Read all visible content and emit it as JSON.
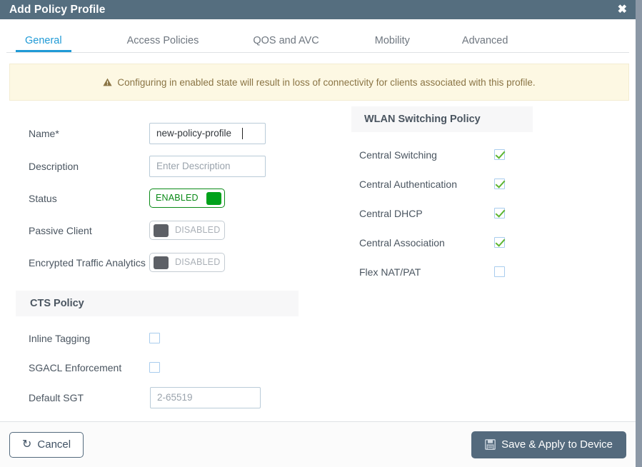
{
  "window": {
    "title": "Add Policy Profile",
    "close_icon": "close-icon",
    "close_glyph": "✖"
  },
  "tabs": [
    {
      "label": "General",
      "active": true
    },
    {
      "label": "Access Policies",
      "active": false
    },
    {
      "label": "QOS and AVC",
      "active": false
    },
    {
      "label": "Mobility",
      "active": false
    },
    {
      "label": "Advanced",
      "active": false
    }
  ],
  "banner": {
    "icon": "warning-triangle-icon",
    "message": "Configuring in enabled state will result in loss of connectivity for clients associated with this profile."
  },
  "general": {
    "name": {
      "label": "Name*",
      "value": "new-policy-profile",
      "placeholder": ""
    },
    "description": {
      "label": "Description",
      "value": "",
      "placeholder": "Enter Description"
    },
    "status": {
      "label": "Status",
      "state": "ENABLED"
    },
    "passive_client": {
      "label": "Passive Client",
      "state": "DISABLED"
    },
    "encrypted_traffic_analytics": {
      "label": "Encrypted Traffic Analytics",
      "state": "DISABLED"
    }
  },
  "cts_policy": {
    "header": "CTS Policy",
    "inline_tagging": {
      "label": "Inline Tagging",
      "checked": false
    },
    "sgacl_enforcement": {
      "label": "SGACL Enforcement",
      "checked": false
    },
    "default_sgt": {
      "label": "Default SGT",
      "value": "",
      "placeholder": "2-65519"
    }
  },
  "wlan_switching_policy": {
    "header": "WLAN Switching Policy",
    "items": [
      {
        "label": "Central Switching",
        "checked": true
      },
      {
        "label": "Central Authentication",
        "checked": true
      },
      {
        "label": "Central DHCP",
        "checked": true
      },
      {
        "label": "Central Association",
        "checked": true
      },
      {
        "label": "Flex NAT/PAT",
        "checked": false
      }
    ]
  },
  "footer": {
    "cancel": {
      "label": "Cancel",
      "icon": "undo-arrow-icon",
      "glyph": "↺"
    },
    "save": {
      "label": "Save & Apply to Device",
      "icon": "floppy-disk-save-icon"
    }
  },
  "colors": {
    "titlebar": "#556e7f",
    "accent_tab": "#1f9ad6",
    "banner_bg": "#fdf8e3",
    "banner_text": "#8a7444",
    "toggle_on": "#00a21b",
    "toggle_off": "#5d6066",
    "check_green": "#5cb531",
    "primary_button": "#546a7d"
  }
}
